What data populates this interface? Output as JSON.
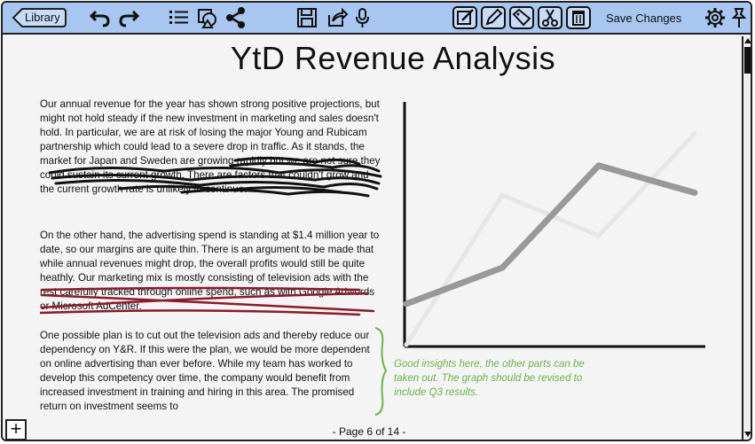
{
  "toolbar": {
    "library_label": "Library",
    "save_label": "Save Changes",
    "icons": [
      "undo-icon",
      "redo-icon",
      "list-icon",
      "shapes-icon",
      "share-icon",
      "save-icon",
      "export-icon",
      "microphone-icon",
      "edit-icon",
      "pen-icon",
      "tag-icon",
      "scissors-icon",
      "trash-icon",
      "settings-icon",
      "pin-icon"
    ]
  },
  "document": {
    "title": "YtD Revenue Analysis",
    "paragraph1": "Our annual revenue for the year has shown strong positive projections, but might not hold steady if the new investment in marketing and sales doesn't hold.  In particular, we are at risk of losing the major Young and Rubicam partnership which could lead to a severe drop in traffic.  As it stands, the market for Japan and Sweden are growing rapidly but we are not sure they could sustain its current growth.  There are factors that couldn't grow and the current growth rate is unlikely to continue.",
    "paragraph2": "On the other hand, the advertising spend is standing at $1.4 million year to date, so our margins are quite thin.  There is an argument to be made that while annual revenues might drop, the overall profits would still be quite heathly.  Our marketing mix is mostly consisting of television ads with the rest carefully tracked through online spend, such as with Google Adwords or Microsoft AdCenter.",
    "paragraph3": "One possible plan is to cut out the television ads and thereby reduce our dependency on Y&R.  If this were the plan, we would be more dependent on online advertising than ever before.  While my team has worked to develop this competency over time, the company would benefit from increased investment in training and hiring in this area.  The promised return on investment seems to",
    "annotation": "Good insights here, the other parts can be taken out.  The graph should be revised to include Q3 results.",
    "page_indicator": "- Page 6 of 14 -"
  },
  "colors": {
    "toolbar": "#a8c6f0",
    "annotation": "#6cb24a",
    "strike": "#8b1a2b",
    "line_dark": "#999999",
    "line_light": "#e6e6e6"
  },
  "chart_data": {
    "type": "line",
    "series": [
      {
        "values": [
          0.18,
          0.34,
          0.79,
          0.67
        ]
      },
      {
        "values": [
          0.0,
          0.66,
          0.48,
          0.93
        ]
      }
    ],
    "ylim": [
      0,
      1
    ]
  }
}
